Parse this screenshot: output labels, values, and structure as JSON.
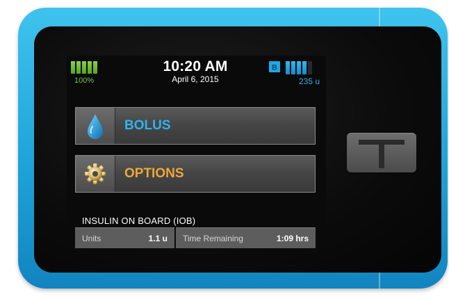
{
  "status": {
    "battery_percent": "100%",
    "battery_level": 1.0,
    "time": "10:20 AM",
    "date": "April 6, 2015",
    "badge_letter": "B",
    "reservoir_units": "235 u",
    "reservoir_level": 0.8
  },
  "menu": {
    "bolus_label": "BOLUS",
    "options_label": "OPTIONS"
  },
  "iob": {
    "title": "INSULIN ON BOARD (IOB)",
    "units_label": "Units",
    "units_value": "1.1 u",
    "time_label": "Time Remaining",
    "time_value": "1:09 hrs"
  },
  "colors": {
    "shell": "#1ea4d9",
    "bolus_text": "#2fb4ee",
    "options_text": "#eea63a",
    "battery": "#6bbf2e",
    "reservoir": "#1ea7e6"
  },
  "icons": {
    "bolus": "water-drop-icon",
    "options": "gear-icon",
    "device_button": "t-logo-icon",
    "badge": "b-badge-icon"
  }
}
